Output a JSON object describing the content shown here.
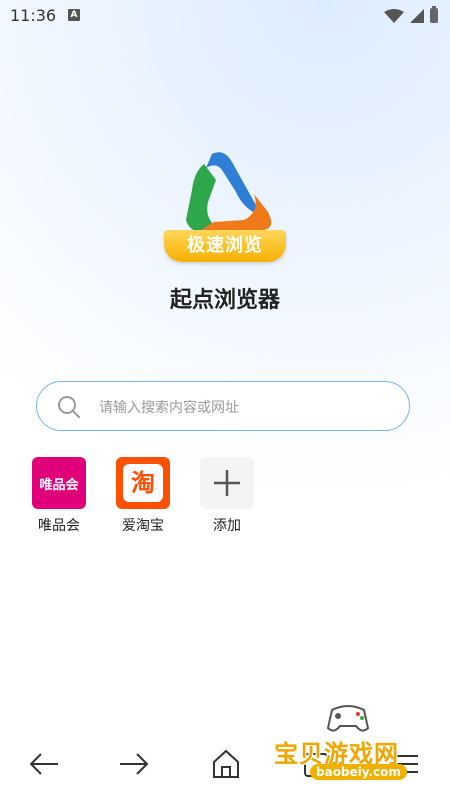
{
  "status": {
    "time": "11:36",
    "notification_letter": "A"
  },
  "app": {
    "logo_banner_text": "极速浏览",
    "title": "起点浏览器"
  },
  "search": {
    "placeholder": "请输入搜索内容或网址"
  },
  "shortcuts": [
    {
      "label": "唯品会",
      "icon_text": "唯品会",
      "icon": "vipshop-icon",
      "color": "#e0007a"
    },
    {
      "label": "爱淘宝",
      "icon_text": "淘",
      "icon": "taobao-icon",
      "color": "#ff5000"
    },
    {
      "label": "添加",
      "icon": "plus-icon"
    }
  ],
  "bottom_nav": [
    "back-arrow-icon",
    "forward-arrow-icon",
    "home-icon",
    "tabs-icon",
    "menu-icon"
  ],
  "watermark": {
    "text": "宝贝游戏网",
    "url": "baobeiy.com"
  }
}
